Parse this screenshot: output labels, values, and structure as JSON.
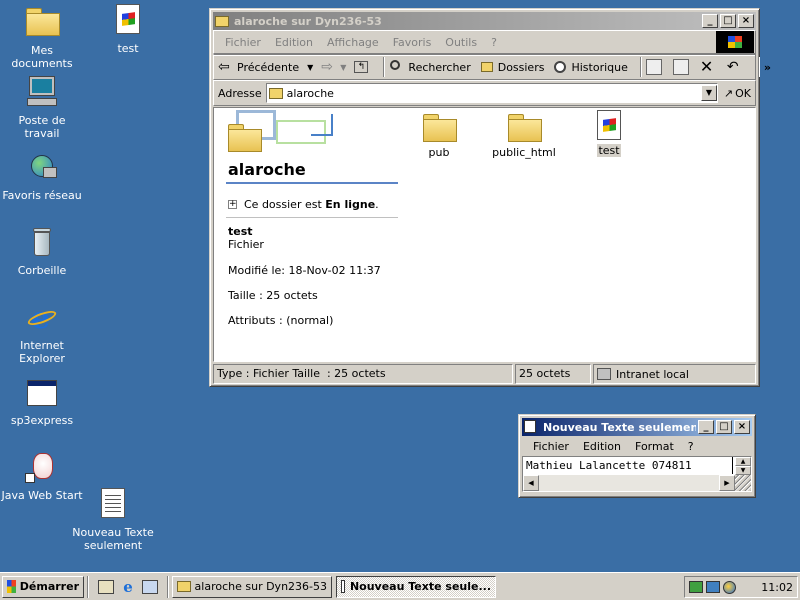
{
  "desktop_icons": [
    {
      "label": "Mes documents",
      "icon": "my-documents-icon"
    },
    {
      "label": "test",
      "icon": "document-icon"
    },
    {
      "label": "Poste de travail",
      "icon": "my-computer-icon"
    },
    {
      "label": "Favoris réseau",
      "icon": "network-icon"
    },
    {
      "label": "Corbeille",
      "icon": "recycle-bin-icon"
    },
    {
      "label": "Internet Explorer",
      "icon": "ie-icon"
    },
    {
      "label": "sp3express",
      "icon": "app-icon"
    },
    {
      "label": "Java Web Start",
      "icon": "java-icon"
    },
    {
      "label": "Nouveau Texte seulement",
      "icon": "text-file-icon"
    }
  ],
  "explorer": {
    "title": "alaroche sur Dyn236-53",
    "menu": [
      "Fichier",
      "Edition",
      "Affichage",
      "Favoris",
      "Outils",
      "?"
    ],
    "toolbar": {
      "back": "Précédente",
      "search": "Rechercher",
      "folders": "Dossiers",
      "history": "Historique",
      "more": "»"
    },
    "address_label": "Adresse",
    "address_value": "alaroche",
    "go_label": "OK",
    "left_panel": {
      "folder_name": "alaroche",
      "online_prefix": "Ce dossier est ",
      "online_status": "En ligne",
      "online_suffix": ".",
      "selected_name": "test",
      "selected_type": "Fichier",
      "modified": "Modifié le: 18-Nov-02 11:37",
      "size": "Taille : 25 octets",
      "attributes": "Attributs : (normal)"
    },
    "items": [
      {
        "label": "pub",
        "kind": "folder"
      },
      {
        "label": "public_html",
        "kind": "folder"
      },
      {
        "label": "test",
        "kind": "file"
      }
    ],
    "status": {
      "main": "Type : Fichier Taille  : 25 octets",
      "size": "25 octets",
      "zone": "Intranet local"
    }
  },
  "notepad": {
    "title": "Nouveau Texte seulement...",
    "menu": [
      "Fichier",
      "Edition",
      "Format",
      "?"
    ],
    "content": "Mathieu Lalancette 074811"
  },
  "taskbar": {
    "start": "Démarrer",
    "tasks": [
      "alaroche sur Dyn236-53",
      "Nouveau Texte seule..."
    ],
    "clock": "11:02"
  },
  "colors": {
    "desktop": "#3a6ea5",
    "title_active": "#0a246a",
    "title_inactive": "#808080",
    "face": "#d4d0c8"
  }
}
